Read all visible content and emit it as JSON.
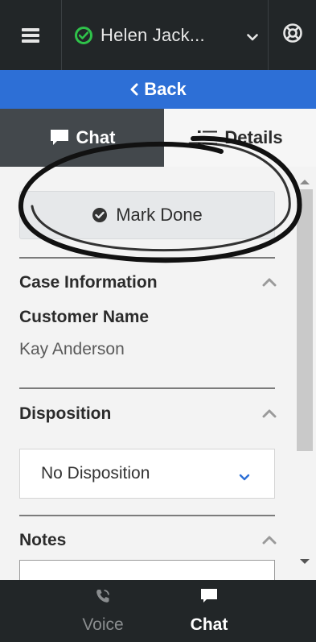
{
  "topbar": {
    "menu_icon": "hamburger-icon",
    "agent_name": "Helen Jack...",
    "agent_status_icon": "check-circle-icon",
    "agent_status_color": "#2fc24a",
    "dropdown_icon": "chevron-down-icon",
    "help_icon": "lifebuoy-icon"
  },
  "back_bar": {
    "label": "Back",
    "color": "#2d6fd6",
    "icon": "chevron-left-icon"
  },
  "tabs": [
    {
      "label": "Chat",
      "icon": "chat-bubble-icon",
      "active": true
    },
    {
      "label": "Details",
      "icon": "list-icon",
      "active": false
    }
  ],
  "actions": {
    "mark_done": "Mark Done",
    "mark_done_icon": "check-circle-icon"
  },
  "case_info": {
    "title": "Case Information",
    "fields": [
      {
        "label": "Customer Name",
        "value": "Kay Anderson"
      }
    ]
  },
  "disposition": {
    "title": "Disposition",
    "value": "No Disposition"
  },
  "notes": {
    "title": "Notes",
    "value": ""
  },
  "bottom_nav": [
    {
      "label": "Voice",
      "icon": "phone-icon",
      "active": false
    },
    {
      "label": "Chat",
      "icon": "chat-bubble-icon",
      "active": true
    }
  ]
}
